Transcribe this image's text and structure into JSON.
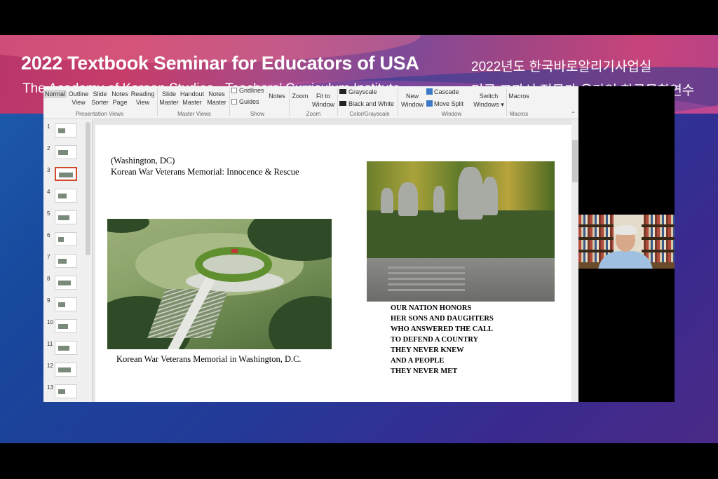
{
  "banner": {
    "title": "2022 Textbook Seminar for Educators of USA",
    "subtitle": "The Academy of Korean Studies - Teachers’ Curriculum Institute",
    "kr_line1": "2022년도 한국바로알리기사업실",
    "kr_line2": "미국 교과서 전문가 온라인 한국문화연수"
  },
  "ribbon": {
    "presentation_views": {
      "normal": "Normal",
      "outline_view": "Outline\nView",
      "slide_sorter": "Slide\nSorter",
      "notes_page": "Notes\nPage",
      "reading_view": "Reading\nView",
      "group_label": "Presentation Views"
    },
    "master_views": {
      "slide_master": "Slide\nMaster",
      "handout_master": "Handout\nMaster",
      "notes_master": "Notes\nMaster",
      "group_label": "Master Views"
    },
    "show": {
      "gridlines": "Gridlines",
      "guides": "Guides",
      "notes": "Notes",
      "group_label": "Show"
    },
    "zoom": {
      "zoom": "Zoom",
      "fit_to_window": "Fit to\nWindow",
      "group_label": "Zoom"
    },
    "color": {
      "grayscale": "Grayscale",
      "black_and_white": "Black and White",
      "group_label": "Color/Grayscale"
    },
    "window": {
      "new_window": "New\nWindow",
      "cascade": "Cascade",
      "move_split": "Move Split",
      "switch_windows": "Switch\nWindows ▾",
      "group_label": "Window"
    },
    "macros": {
      "macros": "Macros",
      "group_label": "Macros"
    },
    "collapse_glyph": "⌃"
  },
  "thumbnails": [
    "1",
    "2",
    "3",
    "4",
    "5",
    "6",
    "7",
    "8",
    "9",
    "10",
    "11",
    "12",
    "13"
  ],
  "selected_slide": "3",
  "slide": {
    "location": "(Washington, DC)",
    "heading": "Korean War Veterans Memorial: Innocence & Rescue",
    "caption": "Korean War Veterans Memorial in Washington, D.C.",
    "poem": [
      "OUR NATION HONORS",
      "HER SONS AND DAUGHTERS",
      "WHO ANSWERED THE CALL",
      "TO DEFEND A COUNTRY",
      "THEY NEVER KNEW",
      "AND A PEOPLE",
      "THEY NEVER MET"
    ]
  },
  "colors": {
    "selected_thumb_border": "#d04a2a",
    "ribbon_bg": "#f3f3f3"
  }
}
